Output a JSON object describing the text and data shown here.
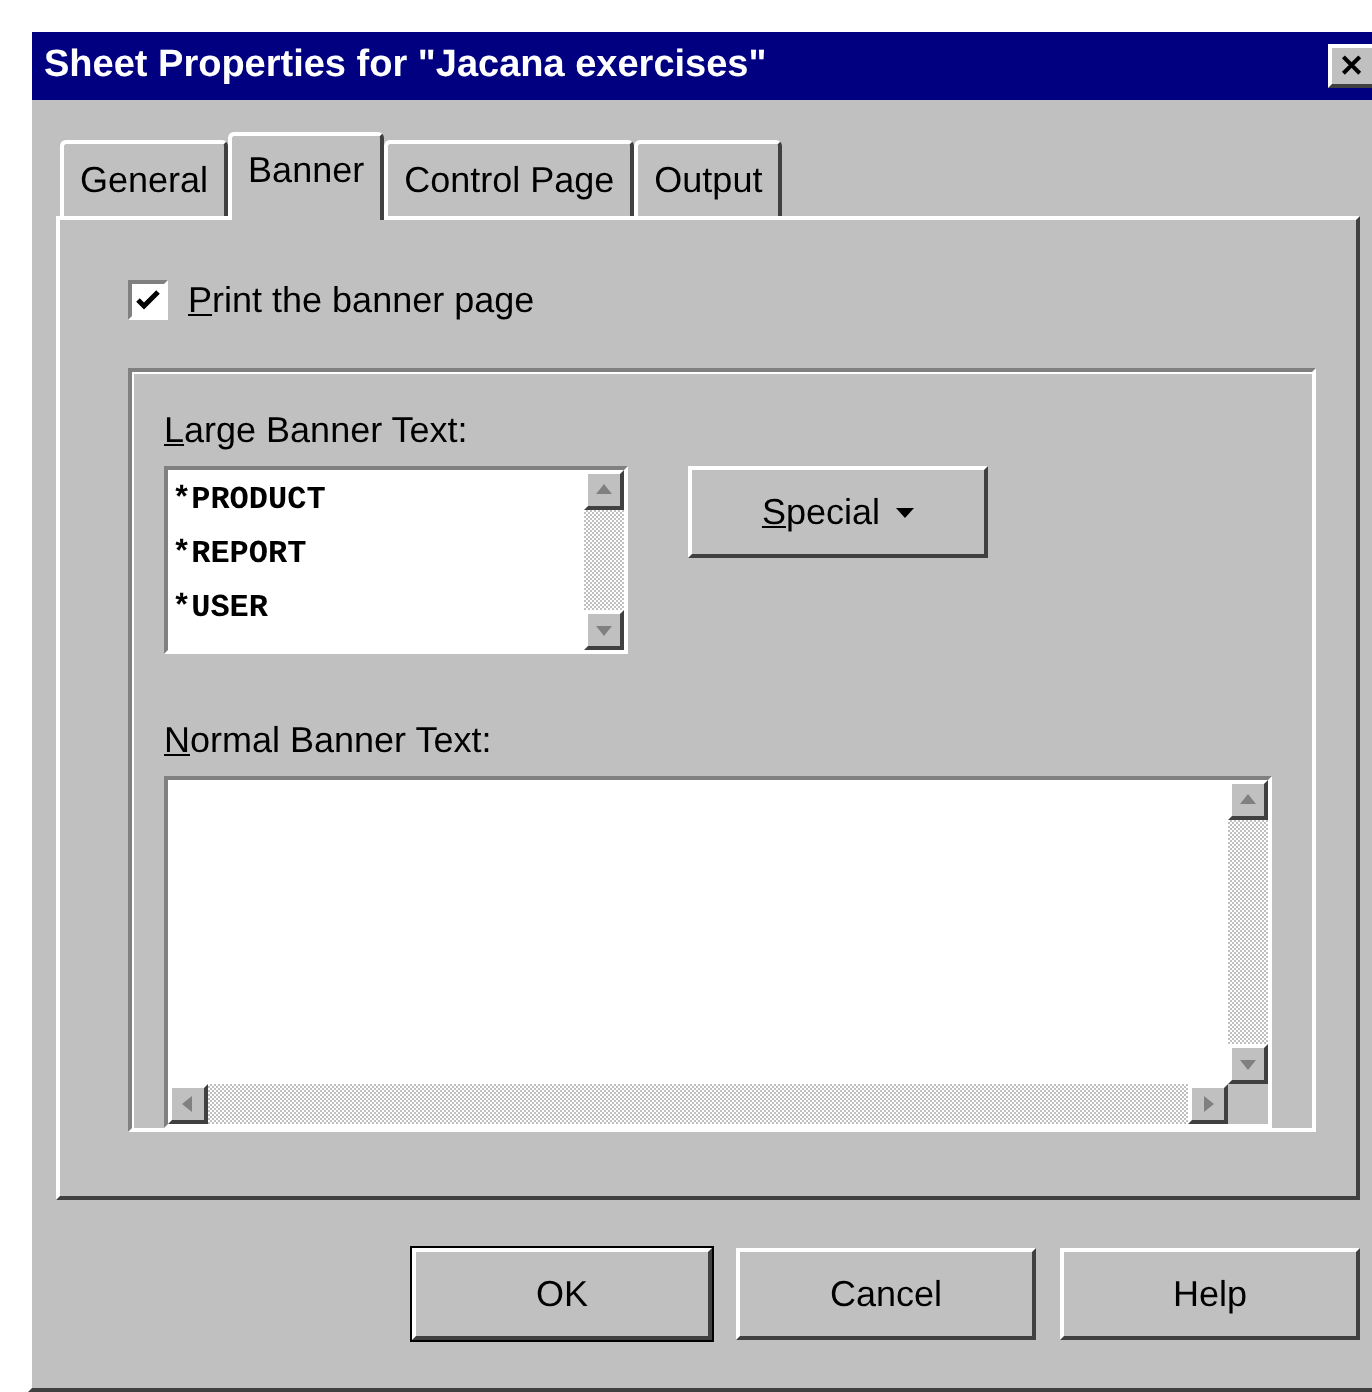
{
  "window": {
    "title": "Sheet Properties for \"Jacana exercises\"",
    "close_glyph": "✕"
  },
  "tabs": [
    {
      "label": "General",
      "selected": false
    },
    {
      "label": "Banner",
      "selected": true
    },
    {
      "label": "Control Page",
      "selected": false
    },
    {
      "label": "Output",
      "selected": false
    }
  ],
  "print_banner": {
    "label": "Print the banner page",
    "checked": true,
    "mnemonic_underlined": true
  },
  "large_banner": {
    "label": "Large Banner Text:",
    "mnemonic_underlined": true,
    "lines": [
      "*PRODUCT",
      "*REPORT",
      "*USER"
    ]
  },
  "special_button": {
    "label": "Special",
    "mnemonic_underlined": true
  },
  "normal_banner": {
    "label": "Normal Banner Text:",
    "mnemonic_underlined": true
  },
  "buttons": [
    {
      "label": "OK",
      "default": true
    },
    {
      "label": "Cancel",
      "default": false
    },
    {
      "label": "Help",
      "default": false
    }
  ]
}
